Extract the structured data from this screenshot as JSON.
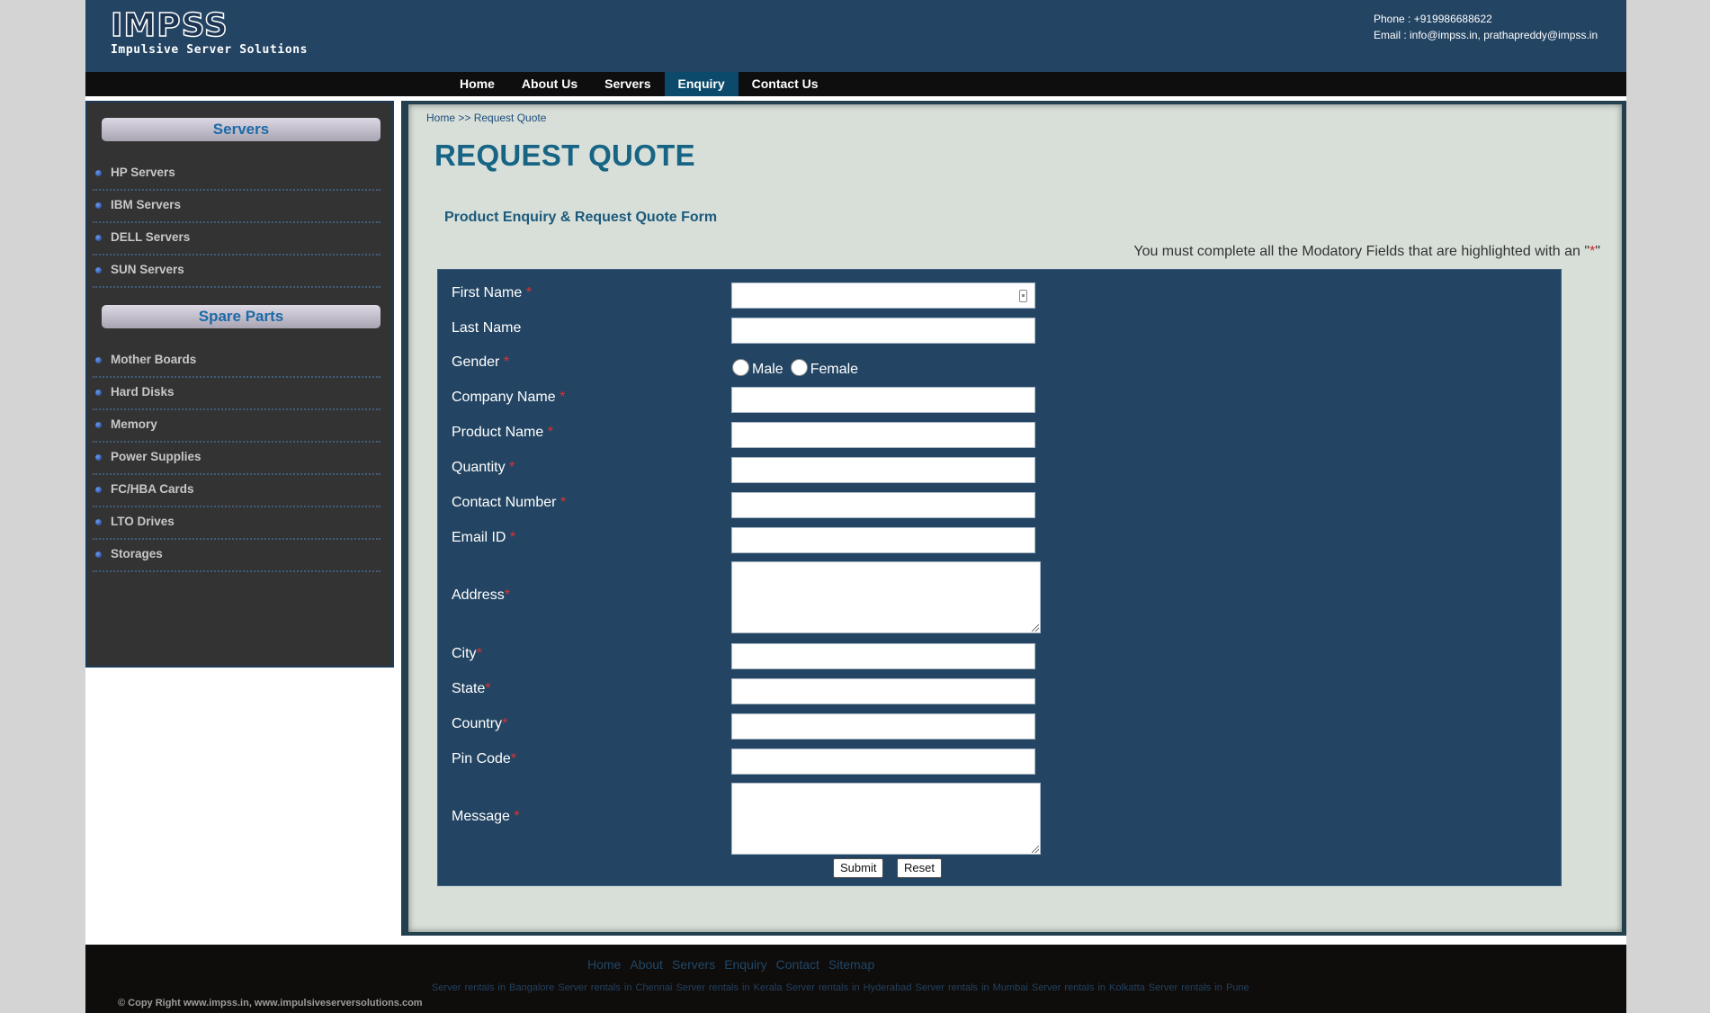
{
  "header": {
    "logo_text": "IMPSS",
    "tagline": "Impulsive Server Solutions",
    "phone": "Phone : +919986688622",
    "email": "Email  : info@impss.in, prathapreddy@impss.in"
  },
  "nav": {
    "items": [
      {
        "label": "Home",
        "active": false
      },
      {
        "label": "About Us",
        "active": false
      },
      {
        "label": "Servers",
        "active": false
      },
      {
        "label": "Enquiry",
        "active": true
      },
      {
        "label": "Contact Us",
        "active": false
      }
    ]
  },
  "sidebar": {
    "servers_heading": "Servers",
    "servers": [
      "HP Servers",
      "IBM Servers",
      "DELL Servers",
      "SUN Servers"
    ],
    "parts_heading": "Spare Parts",
    "parts": [
      "Mother Boards",
      "Hard Disks",
      "Memory",
      "Power Supplies",
      "FC/HBA Cards",
      "LTO Drives",
      "Storages"
    ]
  },
  "main": {
    "breadcrumb": "Home >> Request Quote",
    "title": "REQUEST QUOTE",
    "form_title": "Product Enquiry & Request Quote Form",
    "required_note": "You must complete all the Modatory Fields that are highlighted with an",
    "required_mark": "*",
    "quote_open": "\"",
    "quote_close": "\""
  },
  "form": {
    "first_name": "First Name",
    "last_name": "Last Name",
    "gender": "Gender",
    "male": "Male",
    "female": "Female",
    "company_name": "Company Name",
    "product_name": "Product Name",
    "quantity": "Quantity",
    "contact_number": "Contact Number",
    "email_id": "Email ID",
    "address": "Address",
    "city": "City",
    "state": "State",
    "country": "Country",
    "pin_code": "Pin Code",
    "message": "Message",
    "star": "*",
    "submit": "Submit",
    "reset": "Reset"
  },
  "footer": {
    "links": [
      "Home",
      "About",
      "Servers",
      "Enquiry",
      "Contact",
      "Sitemap"
    ],
    "seo": "Server rentals in Bangalore Server rentals in Chennai Server rentals in Kerala Server rentals in Hyderabad Server rentals in Mumbai Server rentals in Kolkatta Server rentals in Pune",
    "copyright": "© Copy Right www.impss.in, www.impulsiveserversolutions.com"
  },
  "colors": {
    "header_bg": "#234463",
    "nav_active": "#0c4a6c",
    "title": "#176485",
    "form_bg": "#234563",
    "required_star": "#e03030"
  }
}
